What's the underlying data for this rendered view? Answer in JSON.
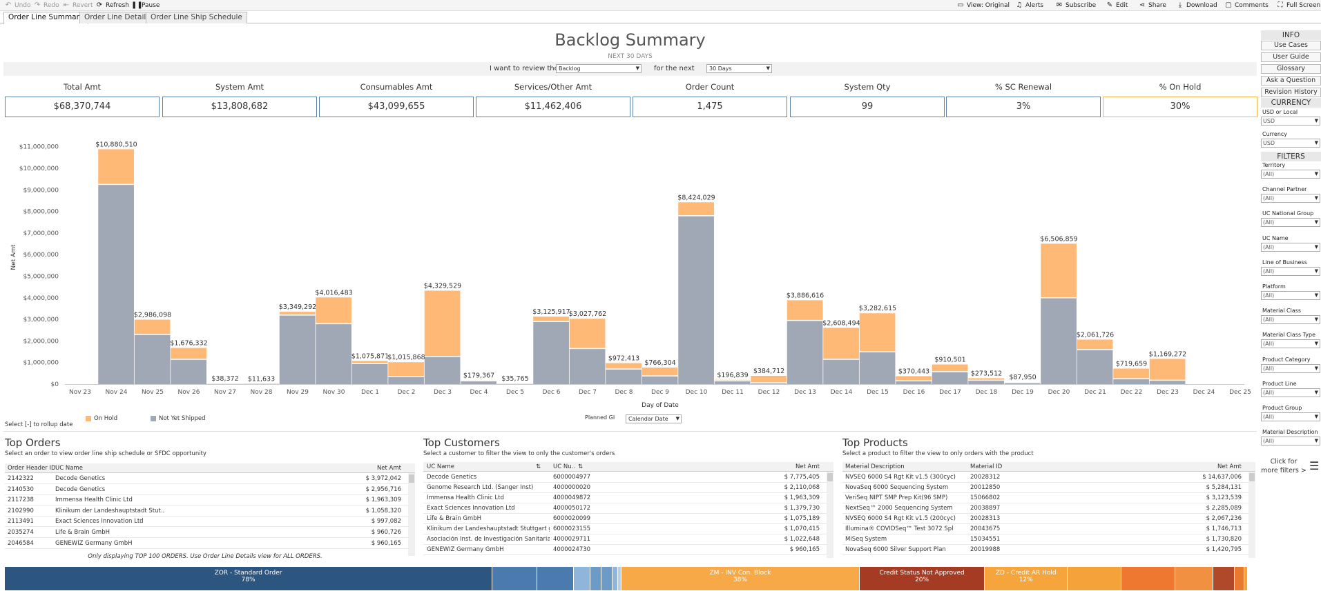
{
  "toolbar": {
    "undo": "Undo",
    "redo": "Redo",
    "revert": "Revert",
    "refresh": "Refresh",
    "pause": "Pause",
    "view": "View: Original",
    "alerts": "Alerts",
    "subscribe": "Subscribe",
    "edit": "Edit",
    "share": "Share",
    "download": "Download",
    "comments": "Comments",
    "fullscreen": "Full Screen"
  },
  "tabs": [
    "Order Line Summary",
    "Order Line Details",
    "Order Line Ship Schedule"
  ],
  "header": {
    "title": "Backlog Summary",
    "subtitle": "NEXT 30 DAYS",
    "review_label": "I want to review the",
    "review_value": "Backlog",
    "next_label": "for the next",
    "next_value": "30 Days"
  },
  "kpis": [
    {
      "label": "Total Amt",
      "value": "$68,370,744"
    },
    {
      "label": "System Amt",
      "value": "$13,808,682"
    },
    {
      "label": "Consumables Amt",
      "value": "$43,099,655"
    },
    {
      "label": "Services/Other Amt",
      "value": "$11,462,406"
    },
    {
      "label": "Order Count",
      "value": "1,475"
    },
    {
      "label": "System Qty",
      "value": "99"
    },
    {
      "label": "% SC Renewal",
      "value": "3%"
    },
    {
      "label": "% On Hold",
      "value": "30%"
    }
  ],
  "colors": {
    "on_hold": "#FFB977",
    "not_shipped": "#A0A7B5",
    "kpi_border": "#5B7FA6",
    "kpi_highlight": "#F0B64A"
  },
  "chart_data": {
    "type": "bar",
    "stacked": true,
    "ylabel": "Net Amt",
    "xlabel": "Day of Date",
    "ylim": [
      0,
      11500000
    ],
    "yticks": [
      "$0",
      "$1,000,000",
      "$2,000,000",
      "$3,000,000",
      "$4,000,000",
      "$5,000,000",
      "$6,000,000",
      "$7,000,000",
      "$8,000,000",
      "$9,000,000",
      "$10,000,000",
      "$11,000,000"
    ],
    "ytick_values": [
      0,
      1000000,
      2000000,
      3000000,
      4000000,
      5000000,
      6000000,
      7000000,
      8000000,
      9000000,
      10000000,
      11000000
    ],
    "categories": [
      "Nov 23",
      "Nov 24",
      "Nov 25",
      "Nov 26",
      "Nov 27",
      "Nov 28",
      "Nov 29",
      "Nov 30",
      "Dec 1",
      "Dec 2",
      "Dec 3",
      "Dec 4",
      "Dec 5",
      "Dec 6",
      "Dec 7",
      "Dec 8",
      "Dec 9",
      "Dec 10",
      "Dec 11",
      "Dec 12",
      "Dec 13",
      "Dec 14",
      "Dec 15",
      "Dec 16",
      "Dec 17",
      "Dec 18",
      "Dec 19",
      "Dec 20",
      "Dec 21",
      "Dec 22",
      "Dec 23",
      "Dec 24",
      "Dec 25"
    ],
    "series": [
      {
        "name": "Not Yet Shipped",
        "values": [
          null,
          9250000,
          2300000,
          1150000,
          30000,
          11633,
          3200000,
          2800000,
          950000,
          350000,
          1280000,
          150000,
          30000,
          2900000,
          1650000,
          700000,
          380000,
          7800000,
          150000,
          60000,
          2950000,
          1150000,
          1500000,
          150000,
          580000,
          180000,
          70000,
          4000000,
          1600000,
          250000,
          180000,
          null,
          null
        ]
      },
      {
        "name": "On Hold",
        "values": [
          null,
          1630510,
          686098,
          526332,
          8372,
          0,
          149292,
          1216483,
          125871,
          665868,
          3049529,
          29367,
          5765,
          225917,
          1377762,
          272413,
          386304,
          624029,
          46839,
          324712,
          936616,
          1458494,
          1782615,
          220443,
          330501,
          93512,
          17950,
          2506859,
          461726,
          469659,
          989272,
          null,
          null
        ]
      }
    ],
    "totals": [
      "",
      "$10,880,510",
      "$2,986,098",
      "$1,676,332",
      "$38,372",
      "$11,633",
      "$3,349,292",
      "$4,016,483",
      "$1,075,871",
      "$1,015,868",
      "$4,329,529",
      "$179,367",
      "$35,765",
      "$3,125,917",
      "$3,027,762",
      "$972,413",
      "$766,304",
      "$8,424,029",
      "$196,839",
      "$384,712",
      "$3,886,616",
      "$2,608,494",
      "$3,282,615",
      "$370,443",
      "$910,501",
      "$273,512",
      "$87,950",
      "$6,506,859",
      "$2,061,726",
      "$719,659",
      "$1,169,272",
      "",
      ""
    ]
  },
  "legend": {
    "rollup": "Select [-] to rollup date",
    "on_hold": "On Hold",
    "not_shipped": "Not Yet Shipped",
    "planned_label": "Planned GI",
    "planned_value": "Calendar Date"
  },
  "top_orders": {
    "title": "Top Orders",
    "subtitle": "Select an order to view order line ship schedule or SFDC opportunity",
    "columns": [
      "Order Header ID",
      "UC Name",
      "Net Amt"
    ],
    "rows": [
      [
        "2142322",
        "Decode Genetics",
        "$ 3,972,042"
      ],
      [
        "2140530",
        "Decode Genetics",
        "$ 2,956,716"
      ],
      [
        "2117238",
        "Immensa Health Clinic Ltd",
        "$ 1,963,309"
      ],
      [
        "2102990",
        "Klinikum der Landeshauptstadt Stut..",
        "$ 1,058,320"
      ],
      [
        "2113491",
        "Exact Sciences Innovation Ltd",
        "$ 997,082"
      ],
      [
        "2035274",
        "Life & Brain GmbH",
        "$ 960,726"
      ],
      [
        "2046584",
        "GENEWIZ Germany GmbH",
        "$ 960,165"
      ]
    ],
    "footnote": "Only displaying TOP 100 ORDERS. Use Order Line Details view for ALL ORDERS."
  },
  "top_customers": {
    "title": "Top Customers",
    "subtitle": "Select a customer to filter the view to only the customer's orders",
    "columns": [
      "UC Name",
      "UC Nu..",
      "Net Amt"
    ],
    "rows": [
      [
        "Decode Genetics",
        "6000004977",
        "$ 7,775,405"
      ],
      [
        "Genome Research Ltd. (Sanger Inst)",
        "4000000020",
        "$ 2,110,068"
      ],
      [
        "Immensa Health Clinic Ltd",
        "4000049872",
        "$ 1,963,309"
      ],
      [
        "Exact Sciences Innovation Ltd",
        "4000050172",
        "$ 1,379,730"
      ],
      [
        "Life & Brain GmbH",
        "6000020099",
        "$ 1,075,189"
      ],
      [
        "Klinikum der Landeshauptstadt Stuttgart gK..",
        "6000023155",
        "$ 1,070,415"
      ],
      [
        "Asociación Inst. de Investigación Sanitaria Bi..",
        "4000029711",
        "$ 1,022,648"
      ],
      [
        "GENEWIZ Germany GmbH",
        "4000024730",
        "$ 960,165"
      ]
    ]
  },
  "top_products": {
    "title": "Top Products",
    "subtitle": "Select a product to filter the view to only orders with the product",
    "columns": [
      "Material Description",
      "Material ID",
      "Net Amt"
    ],
    "rows": [
      [
        "NVSEQ 6000 S4 Rgt Kit v1.5 (300cyc)",
        "20028312",
        "$ 14,637,006"
      ],
      [
        "NovaSeq 6000 Sequencing System",
        "20012850",
        "$ 5,284,131"
      ],
      [
        "VeriSeq NIPT SMP Prep Kit(96 SMP)",
        "15066802",
        "$ 3,123,539"
      ],
      [
        "NextSeq™ 2000 Sequencing System",
        "20038897",
        "$ 2,285,089"
      ],
      [
        "NVSEQ 6000 S4 Rgt Kit v1.5 (200cyc)",
        "20028313",
        "$ 2,067,236"
      ],
      [
        "Illumina® COVIDSeq™ Test 3072 Spl",
        "20043675",
        "$ 1,746,713"
      ],
      [
        "MiSeq System",
        "15034551",
        "$ 1,730,820"
      ],
      [
        "NovaSeq 6000 Silver Support Plan",
        "20019988",
        "$ 1,420,795"
      ]
    ]
  },
  "treemap": [
    {
      "label": "ZOR - Standard Order",
      "pct": "78%",
      "color": "#2C5580",
      "frac": 0.389
    },
    {
      "label": "",
      "pct": "",
      "color": "#4A7AAE",
      "frac": 0.036
    },
    {
      "label": "",
      "pct": "",
      "color": "#4A7AAE",
      "frac": 0.029
    },
    {
      "label": "",
      "pct": "",
      "color": "#8FB6DA",
      "frac": 0.013
    },
    {
      "label": "",
      "pct": "",
      "color": "#6D9BC8",
      "frac": 0.009
    },
    {
      "label": "",
      "pct": "",
      "color": "#6D9BC8",
      "frac": 0.009
    },
    {
      "label": "",
      "pct": "",
      "color": "#8FB6DA",
      "frac": 0.004
    },
    {
      "label": "",
      "pct": "",
      "color": "#B4D0EA",
      "frac": 0.003
    },
    {
      "label": "ZM - INV Con. Block",
      "pct": "38%",
      "color": "#F7A947",
      "frac": 0.19
    },
    {
      "label": "Credit Status Not Approved",
      "pct": "20%",
      "color": "#A63B24",
      "frac": 0.1
    },
    {
      "label": "ZD - Credit AR Hold",
      "pct": "12%",
      "color": "#F5A53C",
      "frac": 0.066
    },
    {
      "label": "",
      "pct": "",
      "color": "#F4A33A",
      "frac": 0.043
    },
    {
      "label": "",
      "pct": "",
      "color": "#EE7830",
      "frac": 0.043
    },
    {
      "label": "",
      "pct": "",
      "color": "#F19040",
      "frac": 0.03
    },
    {
      "label": "",
      "pct": "",
      "color": "#B0492A",
      "frac": 0.017
    },
    {
      "label": "",
      "pct": "",
      "color": "#E8792E",
      "frac": 0.008
    },
    {
      "label": "",
      "pct": "",
      "color": "#F4A33A",
      "frac": 0.003
    }
  ],
  "sidebar": {
    "info_title": "INFO",
    "buttons": [
      "Use Cases",
      "User Guide",
      "Glossary",
      "Ask a Question",
      "Revision History"
    ],
    "currency_title": "CURRENCY",
    "currency_filters": [
      {
        "label": "USD or Local",
        "value": "USD"
      },
      {
        "label": "Currency",
        "value": "USD"
      }
    ],
    "filters_title": "FILTERS",
    "filters": [
      {
        "label": "Territory",
        "value": "(All)"
      },
      {
        "label": "Channel Partner",
        "value": "(All)"
      },
      {
        "label": "UC National Group",
        "value": "(All)"
      },
      {
        "label": "UC Name",
        "value": "(All)"
      },
      {
        "label": "Line of Business",
        "value": "(All)"
      },
      {
        "label": "Platform",
        "value": "(All)"
      },
      {
        "label": "Material Class",
        "value": "(All)"
      },
      {
        "label": "Material Class Type",
        "value": "(All)"
      },
      {
        "label": "Product Category",
        "value": "(All)"
      },
      {
        "label": "Product Line",
        "value": "(All)"
      },
      {
        "label": "Product Group",
        "value": "(All)"
      },
      {
        "label": "Material Description",
        "value": "(All)"
      }
    ],
    "more_filters": "Click for more filters >"
  }
}
